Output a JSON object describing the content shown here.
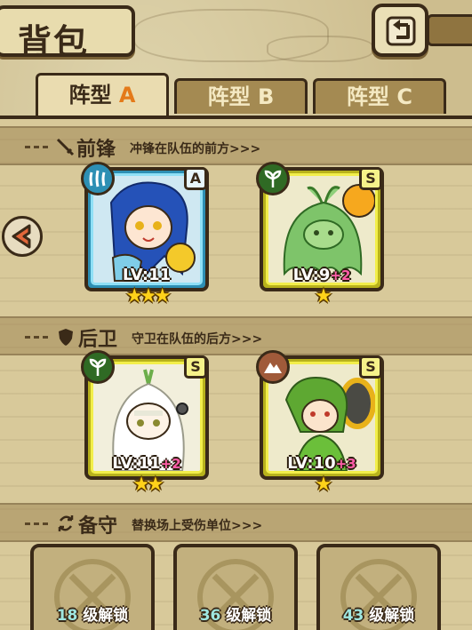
{
  "header": {
    "title": "背包",
    "back_icon": "return-arrow-icon"
  },
  "tabs": [
    {
      "prefix": "阵型",
      "letter": "A",
      "active": true
    },
    {
      "prefix": "阵型",
      "letter": "B",
      "active": false
    },
    {
      "prefix": "阵型",
      "letter": "C",
      "active": false
    }
  ],
  "sections": {
    "vanguard": {
      "title": "前锋",
      "subtitle": "冲锋在队伍的前方>>>",
      "icon": "sword-icon"
    },
    "rearguard": {
      "title": "后卫",
      "subtitle": "守卫在队伍的后方>>>",
      "icon": "shield-icon"
    },
    "reserve": {
      "title": "备守",
      "subtitle": "替换场上受伤单位>>>",
      "icon": "swap-icon"
    }
  },
  "vanguard_cards": [
    {
      "level": "LV:11",
      "bonus": "",
      "rank": "A",
      "stars": 3,
      "element": "water-icon",
      "frame_color": "#5fc4e8",
      "character": "blue-hair-bell-girl"
    },
    {
      "level": "LV:9",
      "bonus": "+2",
      "rank": "S",
      "stars": 1,
      "element": "leaf-icon",
      "frame_color": "#e7e23a",
      "character": "green-slime-sun-girl"
    }
  ],
  "rearguard_cards": [
    {
      "level": "LV:11",
      "bonus": "+2",
      "rank": "S",
      "stars": 2,
      "element": "leaf-icon",
      "frame_color": "#e7e23a",
      "character": "white-onion-girl"
    },
    {
      "level": "LV:10",
      "bonus": "+3",
      "rank": "S",
      "stars": 1,
      "element": "earth-icon",
      "frame_color": "#e7e23a",
      "character": "green-racket-girl"
    }
  ],
  "reserve_slots": [
    {
      "level": "18",
      "suffix": "级解锁"
    },
    {
      "level": "36",
      "suffix": "级解锁"
    },
    {
      "level": "43",
      "suffix": "级解锁"
    }
  ],
  "colors": {
    "outline": "#3a2a18",
    "parchment": "#d8c99a",
    "star": "#ffd21a",
    "bonus": "#ff5ca8",
    "active_tab_letter": "#e47a1a"
  }
}
